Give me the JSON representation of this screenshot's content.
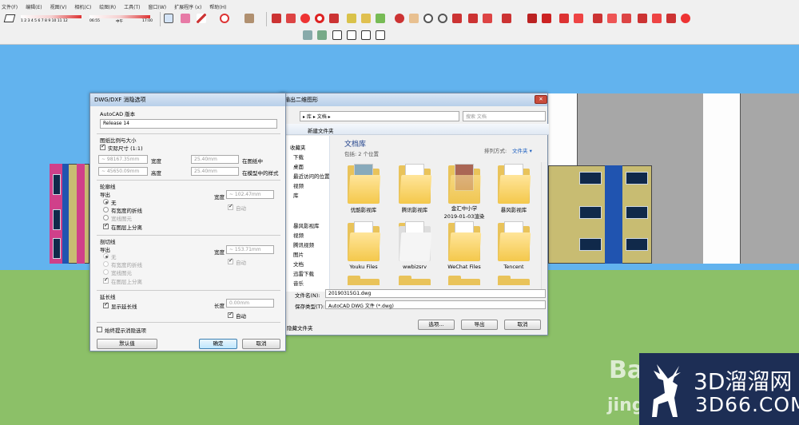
{
  "menu": [
    "文件(F)",
    "编辑(E)",
    "视图(V)",
    "相机(C)",
    "绘图(R)",
    "工具(T)",
    "窗口(W)",
    "扩展程序 (x)",
    "帮助(H)"
  ],
  "shadow": {
    "scale": "1 2 3 4 5 6 7 8 9 10 11 12",
    "t1": "06:55",
    "t2": "中午",
    "t3": "17:00"
  },
  "dwg": {
    "title": "DWG/DXF 消隐选项",
    "version_label": "AutoCAD 版本",
    "version_value": "Release 14",
    "scale_group": "图纸比例与大小",
    "actual_size": "实际尺寸 (1:1)",
    "w1": "~ 98167.35mm",
    "w_label": "宽度",
    "w2": "25.40mm",
    "w_unit": "在图纸中",
    "h1": "~ 45650.09mm",
    "h_label": "高度",
    "h2": "25.40mm",
    "h_unit": "在模型中的样式",
    "profile_group": "轮廓线",
    "export": "导出",
    "none": "无",
    "width_poly": "有宽度的折线",
    "wide_ent": "宽线图元",
    "sep_layer": "在图层上分离",
    "width_label": "宽度",
    "width_val": "~ 102.47mm",
    "auto": "自动",
    "section_group": "剖切线",
    "width_val2": "~ 153.71mm",
    "ext_group": "延长线",
    "show_ext": "显示延长线",
    "length_label": "长度",
    "length_val": "0.00mm",
    "always": "始终提示消隐选项",
    "default_btn": "默认值",
    "ok_btn": "确定",
    "cancel_btn": "取消"
  },
  "save": {
    "title": "输出二维图形",
    "crumbs": "▸ 库 ▸ 文档 ▸",
    "search": "搜索 文档",
    "new_folder": "新建文件夹",
    "lib_title": "文档库",
    "lib_sub": "包括: 2 个位置",
    "sort_label": "排列方式:",
    "sort_value": "文件夹 ▾",
    "nav": [
      "收藏夹",
      "下载",
      "桌面",
      "最近访问的位置",
      "视频",
      "库",
      "暴风影视库",
      "视频",
      "腾讯视频",
      "图片",
      "文档",
      "迅雷下载",
      "音乐"
    ],
    "files": [
      "优酷影视库",
      "腾讯影视库",
      "金汇中小学\n2019-01-03渲染",
      "暴风影视库",
      "Youku Files",
      "wwbizsrv",
      "WeChat Files",
      "Tencent"
    ],
    "filename_label": "文件名(N):",
    "filename": "20190315G1.dwg",
    "type_label": "保存类型(T):",
    "type": "AutoCAD DWG 文件 (*.dwg)",
    "hide": "隐藏文件夹",
    "options_btn": "选项...",
    "export_btn": "导出",
    "cancel_btn": "取消"
  },
  "watermark": {
    "cn": "3D溜溜网",
    "en": "3D66.COM",
    "bai": "Bai",
    "jing": "jing"
  }
}
